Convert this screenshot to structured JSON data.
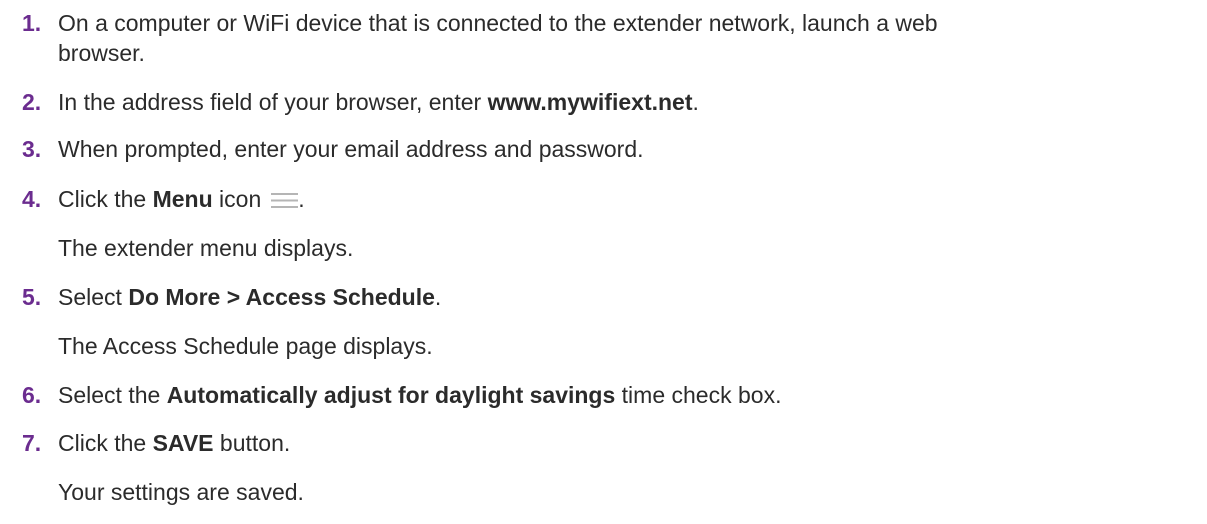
{
  "steps": [
    {
      "number": "1.",
      "text_line1": "On a computer or WiFi device that is connected to the extender network, launch a web",
      "text_line2": "browser."
    },
    {
      "number": "2.",
      "text_before": "In the address field of your browser, enter ",
      "bold": "www.mywifiext.net",
      "text_after": "."
    },
    {
      "number": "3.",
      "text": "When prompted, enter your email address and password."
    },
    {
      "number": "4.",
      "text_before": "Click the ",
      "bold": "Menu",
      "text_mid": " icon",
      "text_after": ".",
      "icon": "hamburger-menu-icon",
      "result": "The extender menu displays."
    },
    {
      "number": "5.",
      "text_before": "Select ",
      "bold": "Do More > Access Schedule",
      "text_after": ".",
      "result": "The Access Schedule page displays."
    },
    {
      "number": "6.",
      "text_before": "Select the ",
      "bold": "Automatically adjust for daylight savings",
      "text_after": " time check box."
    },
    {
      "number": "7.",
      "text_before": "Click the ",
      "bold": "SAVE",
      "text_after": " button.",
      "result": "Your settings are saved."
    }
  ],
  "colors": {
    "step_number": "#6b2c8f",
    "body_text": "#2b2b2b",
    "icon": "#b5b5b5"
  }
}
